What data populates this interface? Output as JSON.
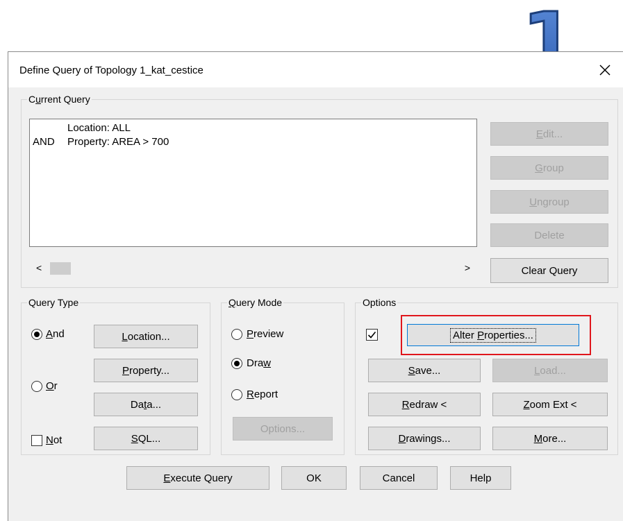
{
  "badge": {
    "text": "1"
  },
  "dialog": {
    "title": "Define Query of Topology 1_kat_cestice",
    "current_query": {
      "legend_pre": "C",
      "legend_u": "u",
      "legend_post": "rrent Query",
      "lines": [
        "Location: ALL",
        "Property: AREA > 700"
      ],
      "line_prefixes": [
        "",
        "AND"
      ],
      "buttons": {
        "edit": {
          "u": "E",
          "rest": "dit..."
        },
        "group": {
          "u": "G",
          "rest": "roup"
        },
        "ungroup": {
          "u": "U",
          "rest": "ngroup"
        },
        "delete": "Delete",
        "clear": "Clear Query"
      },
      "scroll_left": "<",
      "scroll_right": ">"
    },
    "query_type": {
      "legend": "Query Type",
      "and": {
        "u": "A",
        "rest": "nd"
      },
      "or": {
        "u": "O",
        "rest": "r"
      },
      "not": {
        "u": "N",
        "rest": "ot"
      },
      "location": {
        "u": "L",
        "rest": "ocation..."
      },
      "property": {
        "u": "P",
        "rest": "roperty..."
      },
      "data": {
        "pre": "Da",
        "u": "t",
        "rest": "a..."
      },
      "sql": {
        "u": "S",
        "rest": "QL..."
      }
    },
    "query_mode": {
      "legend_u": "Q",
      "legend_rest": "uery Mode",
      "preview": {
        "u": "P",
        "rest": "review"
      },
      "draw": {
        "pre": "Dra",
        "u": "w",
        "rest": ""
      },
      "report": {
        "u": "R",
        "rest": "eport"
      },
      "options": "Options..."
    },
    "options": {
      "legend": "Options",
      "alter": {
        "pre": "Alter ",
        "u": "P",
        "rest": "roperties..."
      },
      "save": {
        "u": "S",
        "rest": "ave..."
      },
      "load": {
        "u": "L",
        "rest": "oad..."
      },
      "redraw": {
        "u": "R",
        "rest": "edraw <"
      },
      "zoom": {
        "u": "Z",
        "rest": "oom Ext <"
      },
      "drawings": {
        "u": "D",
        "rest": "rawings..."
      },
      "more": {
        "u": "M",
        "rest": "ore..."
      }
    },
    "footer": {
      "execute": {
        "u": "E",
        "rest": "xecute Query"
      },
      "ok": "OK",
      "cancel": "Cancel",
      "help": "Help"
    }
  },
  "colors": {
    "highlight": "#e0161c",
    "badge": "#4472c4"
  }
}
